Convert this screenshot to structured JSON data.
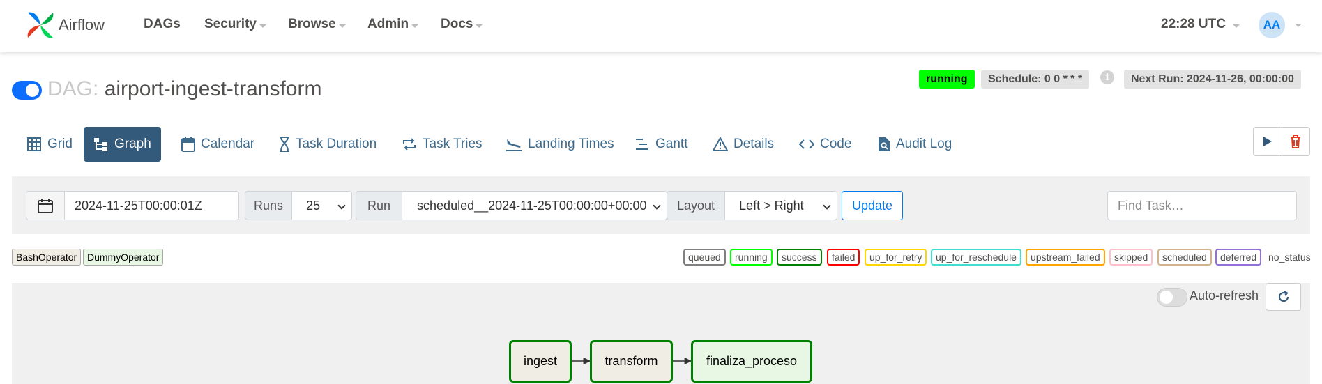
{
  "navbar": {
    "brand": "Airflow",
    "menu": [
      {
        "label": "DAGs",
        "caret": false
      },
      {
        "label": "Security",
        "caret": true
      },
      {
        "label": "Browse",
        "caret": true
      },
      {
        "label": "Admin",
        "caret": true
      },
      {
        "label": "Docs",
        "caret": true
      }
    ],
    "clock": "22:28 UTC",
    "avatar_initials": "AA"
  },
  "dag": {
    "prefix": "DAG:",
    "name": "airport-ingest-transform",
    "paused": false,
    "state_badge": "running",
    "schedule": "Schedule: 0 0 * * *",
    "next_run": "Next Run: 2024-11-26, 00:00:00"
  },
  "tabs": [
    {
      "label": "Grid",
      "icon": "grid-icon",
      "active": false
    },
    {
      "label": "Graph",
      "icon": "graph-icon",
      "active": true
    },
    {
      "label": "Calendar",
      "icon": "calendar-icon",
      "active": false
    },
    {
      "label": "Task Duration",
      "icon": "hourglass-icon",
      "active": false
    },
    {
      "label": "Task Tries",
      "icon": "repeat-icon",
      "active": false
    },
    {
      "label": "Landing Times",
      "icon": "plane-landing-icon",
      "active": false
    },
    {
      "label": "Gantt",
      "icon": "gantt-icon",
      "active": false
    },
    {
      "label": "Details",
      "icon": "warning-triangle-icon",
      "active": false
    },
    {
      "label": "Code",
      "icon": "code-icon",
      "active": false
    },
    {
      "label": "Audit Log",
      "icon": "file-search-icon",
      "active": false
    }
  ],
  "filters": {
    "date_value": "2024-11-25T00:00:01Z",
    "runs_label": "Runs",
    "runs_value": "25",
    "run_label": "Run",
    "run_value": "scheduled__2024-11-25T00:00:00+00:00",
    "layout_label": "Layout",
    "layout_value": "Left > Right",
    "update_label": "Update",
    "find_placeholder": "Find Task…"
  },
  "operator_legend": [
    {
      "label": "BashOperator",
      "color": "#f0ede4"
    },
    {
      "label": "DummyOperator",
      "color": "#e8f7e4"
    }
  ],
  "state_legend": [
    {
      "label": "queued",
      "color": "#808080"
    },
    {
      "label": "running",
      "color": "#00ff00"
    },
    {
      "label": "success",
      "color": "#008000"
    },
    {
      "label": "failed",
      "color": "#ff0000"
    },
    {
      "label": "up_for_retry",
      "color": "#ffd700"
    },
    {
      "label": "up_for_reschedule",
      "color": "#40e0d0"
    },
    {
      "label": "upstream_failed",
      "color": "#ffa500"
    },
    {
      "label": "skipped",
      "color": "#ffc0cb"
    },
    {
      "label": "scheduled",
      "color": "#d2b48c"
    },
    {
      "label": "deferred",
      "color": "#9370db"
    },
    {
      "label": "no_status",
      "color": "none"
    }
  ],
  "graph": {
    "auto_refresh_label": "Auto-refresh",
    "auto_refresh_on": false,
    "nodes": [
      {
        "label": "ingest",
        "operator": "BashOperator",
        "state": "success"
      },
      {
        "label": "transform",
        "operator": "BashOperator",
        "state": "success"
      },
      {
        "label": "finaliza_proceso",
        "operator": "DummyOperator",
        "state": "success"
      }
    ]
  },
  "colors": {
    "primary": "#017cee",
    "tab_active_bg": "#33597b",
    "tab_text": "#3d6b8e",
    "running_badge": "#00ff00",
    "success_border": "#008000"
  }
}
